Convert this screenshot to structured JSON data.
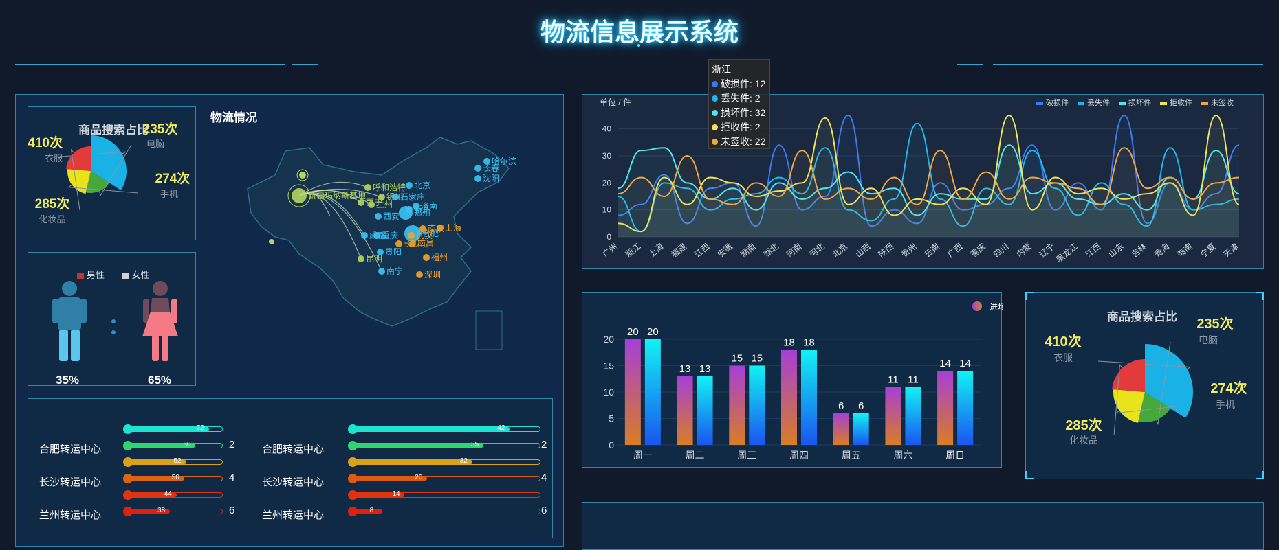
{
  "header": {
    "title": "物流信息展示系统"
  },
  "pie_small": {
    "title": "商品搜索占比",
    "slices": [
      {
        "name": "衣服",
        "count": "410次",
        "value": 410,
        "color": "#1ab2e6"
      },
      {
        "name": "电脑",
        "count": "235次",
        "value": 235,
        "color": "#46a73a"
      },
      {
        "name": "手机",
        "count": "274次",
        "value": 274,
        "color": "#e8e31b"
      },
      {
        "name": "化妆品",
        "count": "285次",
        "value": 285,
        "color": "#e23b3b"
      }
    ]
  },
  "map": {
    "title": "物流情况",
    "cities": [
      "新疆玛纳斯基地",
      "哈尔滨",
      "长春",
      "沈阳",
      "呼和浩特",
      "北京",
      "银川",
      "兰州",
      "西宁",
      "石家庄",
      "济南",
      "西安",
      "郑州",
      "新乡",
      "成都",
      "重庆",
      "合肥",
      "上海",
      "南京",
      "武汉",
      "南昌",
      "长沙",
      "贵阳",
      "昆明",
      "福州",
      "南宁",
      "深圳"
    ]
  },
  "gender": {
    "legend_male": "男性",
    "legend_female": "女性",
    "male_pct": "35%",
    "female_pct": "65%",
    "male_color": "#c9322f",
    "female_color": "#d0d0d0"
  },
  "progress": {
    "left": {
      "labels": [
        "合肥转运中心",
        "长沙转运中心",
        "兰州转运中心"
      ],
      "ranks": [
        "2",
        "4",
        "6"
      ],
      "bars": [
        {
          "value": 72,
          "pct": 0.86,
          "color": "#1de3d2"
        },
        {
          "value": 60,
          "pct": 0.72,
          "color": "#2fd66f"
        },
        {
          "value": 52,
          "pct": 0.62,
          "color": "#d9a21a"
        },
        {
          "value": 50,
          "pct": 0.6,
          "color": "#dd6313"
        },
        {
          "value": 44,
          "pct": 0.52,
          "color": "#e0330f"
        },
        {
          "value": 38,
          "pct": 0.45,
          "color": "#e0200d"
        }
      ]
    },
    "right": {
      "labels": [
        "合肥转运中心",
        "长沙转运中心",
        "兰州转运中心"
      ],
      "ranks": [
        "2",
        "4",
        "6"
      ],
      "bars": [
        {
          "value": 42,
          "pct": 0.84,
          "color": "#1de3d2"
        },
        {
          "value": 35,
          "pct": 0.7,
          "color": "#2fd66f"
        },
        {
          "value": 32,
          "pct": 0.64,
          "color": "#d9a21a"
        },
        {
          "value": 20,
          "pct": 0.4,
          "color": "#dd5a13"
        },
        {
          "value": 14,
          "pct": 0.28,
          "color": "#e0330f"
        },
        {
          "value": 8,
          "pct": 0.16,
          "color": "#e0200d"
        }
      ]
    }
  },
  "tooltip": {
    "title": "浙江",
    "rows": [
      {
        "text": "破损件: 12",
        "color": "#3b7bf0"
      },
      {
        "text": "丢失件: 2",
        "color": "#1fb8ee"
      },
      {
        "text": "损坏件: 32",
        "color": "#4fe6f2"
      },
      {
        "text": "拒收件: 2",
        "color": "#f0e45a"
      },
      {
        "text": "未签收: 22",
        "color": "#f3a642"
      }
    ]
  },
  "chart_data": [
    {
      "type": "line",
      "title": "",
      "ylabel": "单位 / 件",
      "ylim": [
        0,
        45
      ],
      "yticks": [
        0,
        10,
        20,
        30,
        40
      ],
      "x": [
        "广州",
        "浙江",
        "上海",
        "福建",
        "江西",
        "安徽",
        "湖南",
        "湖北",
        "河南",
        "河北",
        "北京",
        "山西",
        "陕西",
        "贵州",
        "云南",
        "广西",
        "重庆",
        "四川",
        "内蒙",
        "辽宁",
        "黑龙江",
        "江西",
        "山东",
        "吉林",
        "青海",
        "海南",
        "宁夏",
        "天津"
      ],
      "series": [
        {
          "name": "破损件",
          "color": "#3b7bf0",
          "values": [
            8,
            12,
            23,
            5,
            18,
            20,
            4,
            34,
            10,
            15,
            45,
            4,
            10,
            5,
            20,
            10,
            12,
            18,
            34,
            10,
            20,
            10,
            45,
            5,
            20,
            10,
            16,
            34
          ]
        },
        {
          "name": "丢失件",
          "color": "#1fb8ee",
          "values": [
            15,
            2,
            20,
            18,
            10,
            14,
            16,
            22,
            16,
            33,
            10,
            6,
            14,
            42,
            14,
            4,
            18,
            12,
            32,
            18,
            8,
            20,
            12,
            4,
            33,
            10,
            12,
            14
          ]
        },
        {
          "name": "损坏件",
          "color": "#4fe6f2",
          "values": [
            18,
            32,
            33,
            20,
            14,
            18,
            10,
            20,
            14,
            18,
            24,
            16,
            18,
            8,
            16,
            14,
            14,
            34,
            16,
            20,
            14,
            12,
            16,
            10,
            22,
            14,
            32,
            16
          ]
        },
        {
          "name": "拒收件",
          "color": "#f0e45a",
          "values": [
            5,
            2,
            22,
            12,
            22,
            20,
            15,
            17,
            20,
            44,
            12,
            18,
            8,
            14,
            12,
            18,
            12,
            45,
            10,
            22,
            16,
            18,
            14,
            16,
            20,
            8,
            45,
            12
          ]
        },
        {
          "name": "未签收",
          "color": "#f3a642",
          "values": [
            16,
            22,
            15,
            30,
            14,
            12,
            20,
            15,
            32,
            14,
            18,
            14,
            22,
            12,
            32,
            14,
            24,
            14,
            22,
            20,
            18,
            12,
            33,
            18,
            22,
            14,
            20,
            22
          ]
        }
      ]
    },
    {
      "type": "bar",
      "categories": [
        "周一",
        "周二",
        "周三",
        "周四",
        "周五",
        "周六",
        "周日"
      ],
      "legend": "进场",
      "ylim": [
        0,
        20
      ],
      "yticks": [
        0,
        5,
        10,
        15,
        20
      ],
      "series": [
        {
          "values": [
            20,
            13,
            15,
            18,
            6,
            11,
            14
          ]
        },
        {
          "values": [
            20,
            13,
            15,
            18,
            6,
            11,
            14
          ]
        }
      ]
    },
    {
      "type": "pie",
      "title": "商品搜索占比",
      "categories": [
        "衣服",
        "电脑",
        "手机",
        "化妆品"
      ],
      "values": [
        410,
        235,
        274,
        285
      ],
      "labels": [
        "410次",
        "235次",
        "274次",
        "285次"
      ]
    }
  ]
}
